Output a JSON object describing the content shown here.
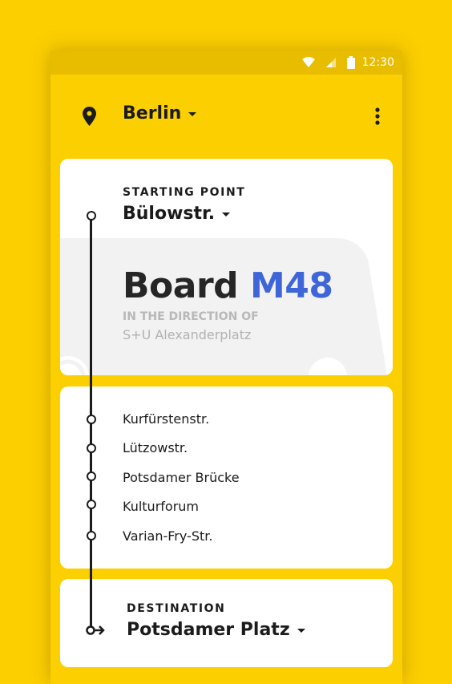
{
  "status_bar": {
    "time": "12:30"
  },
  "app_bar": {
    "city": "Berlin"
  },
  "start": {
    "label": "STARTING POINT",
    "stop": "Bülowstr."
  },
  "board": {
    "prefix": "Board",
    "line": "M48",
    "direction_label": "IN THE DIRECTION OF",
    "direction": "S+U Alexanderplatz"
  },
  "stops": [
    {
      "name": "Kurfürstenstr."
    },
    {
      "name": "Lützowstr."
    },
    {
      "name": "Potsdamer Brücke"
    },
    {
      "name": "Kulturforum"
    },
    {
      "name": "Varian-Fry-Str."
    }
  ],
  "destination": {
    "label": "DESTINATION",
    "stop": "Potsdamer Platz"
  },
  "colors": {
    "background": "#FCCF00",
    "accent": "#3F66D8",
    "text": "#1B1B1B"
  },
  "icons": [
    "wifi-icon",
    "signal-icon",
    "battery-icon",
    "location-pin-icon",
    "more-vert-icon",
    "dropdown-caret-icon",
    "arrow-right-icon"
  ]
}
